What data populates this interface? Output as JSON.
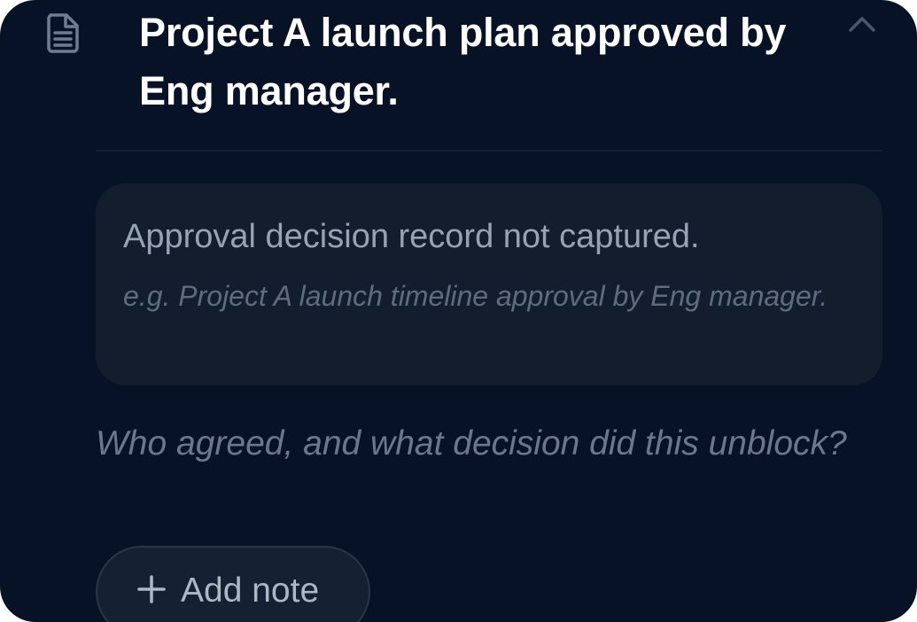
{
  "item": {
    "icon": "document-icon",
    "title": "Project A launch plan approved by Eng manager.",
    "collapse_icon": "chevron-up-icon"
  },
  "record": {
    "status": "Approval decision record not captured.",
    "example": "e.g. Project A launch timeline approval by Eng manager."
  },
  "prompt": "Who agreed, and what decision did this unblock?",
  "add_note": {
    "icon": "plus-icon",
    "label": "Add note"
  },
  "colors": {
    "background": "#081226",
    "panel": "#141d2e",
    "title_text": "#ffffff",
    "muted_text": "#97a2b3"
  }
}
